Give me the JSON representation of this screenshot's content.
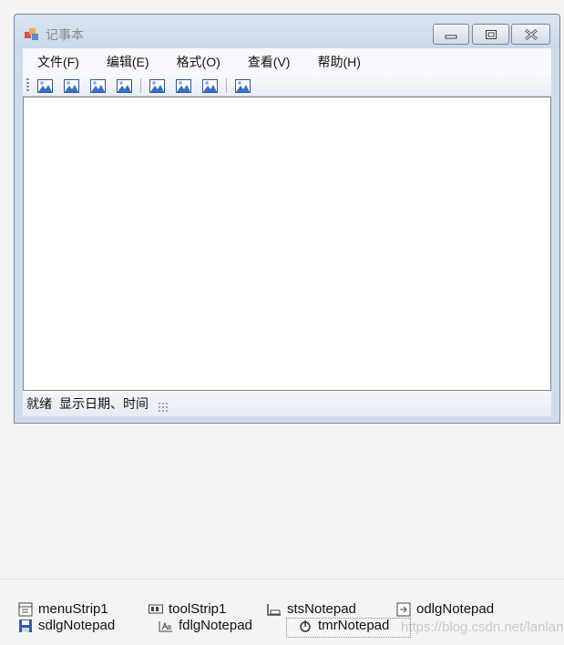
{
  "window": {
    "title": "记事本",
    "menus": [
      "文件(F)",
      "编辑(E)",
      "格式(O)",
      "查看(V)",
      "帮助(H)"
    ],
    "toolbar": {
      "group1_buttons": 4,
      "group2_buttons": 3,
      "group3_buttons": 1,
      "icon": "image-icon"
    },
    "editor_text": "",
    "status": {
      "label1": "就绪",
      "label2": "显示日期、时间"
    }
  },
  "tray": {
    "components": [
      {
        "name": "menuStrip1",
        "icon": "menustrip-icon"
      },
      {
        "name": "toolStrip1",
        "icon": "toolstrip-icon"
      },
      {
        "name": "stsNotepad",
        "icon": "statusstrip-icon"
      },
      {
        "name": "odlgNotepad",
        "icon": "open-dialog-icon"
      },
      {
        "name": "sdlgNotepad",
        "icon": "save-dialog-icon"
      },
      {
        "name": "fdlgNotepad",
        "icon": "font-dialog-icon"
      },
      {
        "name": "tmrNotepad",
        "icon": "timer-icon"
      }
    ]
  },
  "watermark": "https://blog.csdn.net/lanlantanglan"
}
